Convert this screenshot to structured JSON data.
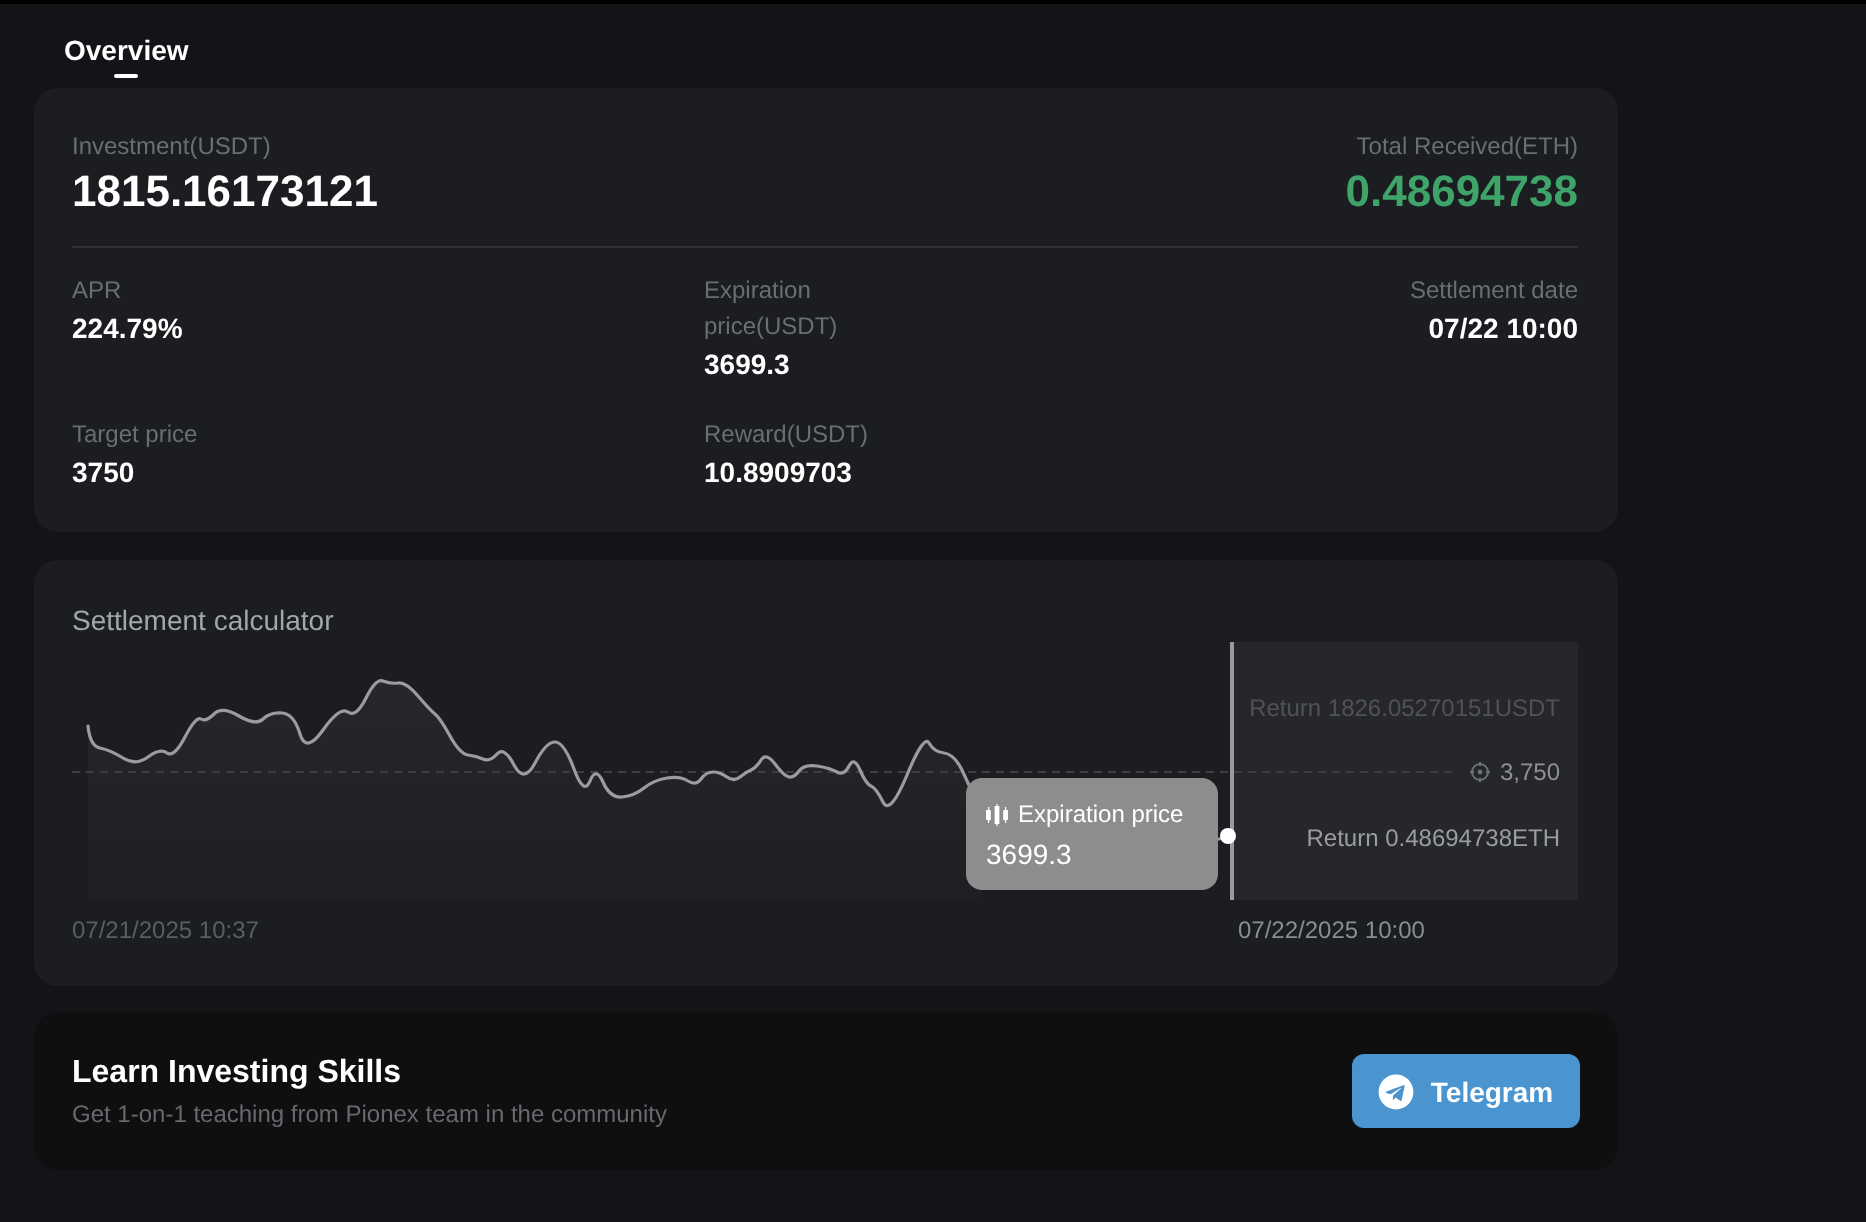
{
  "tabs": [
    {
      "label": "Overview",
      "selected": true
    }
  ],
  "summary": {
    "investment": {
      "label": "Investment(USDT)",
      "value": "1815.16173121"
    },
    "total_received": {
      "label": "Total Received(ETH)",
      "value": "0.48694738"
    },
    "stats": [
      {
        "label": "APR",
        "value": "224.79%"
      },
      {
        "label": "Expiration price(USDT)",
        "value": "3699.3"
      },
      {
        "label": "Settlement date",
        "value": "07/22 10:00"
      },
      {
        "label": "Target price",
        "value": "3750"
      },
      {
        "label": "Reward(USDT)",
        "value": "10.8909703"
      }
    ]
  },
  "calculator": {
    "title": "Settlement calculator",
    "upper_return": "Return 1826.05270151USDT",
    "target_label": "3,750",
    "lower_return": "Return 0.48694738ETH",
    "tooltip": {
      "title": "Expiration price",
      "value": "3699.3"
    },
    "start_date": "07/21/2025 10:37",
    "end_date": "07/22/2025 10:00"
  },
  "promo": {
    "title": "Learn Investing Skills",
    "subtitle": "Get 1-on-1 teaching from Pionex team in the community",
    "button": "Telegram"
  }
}
